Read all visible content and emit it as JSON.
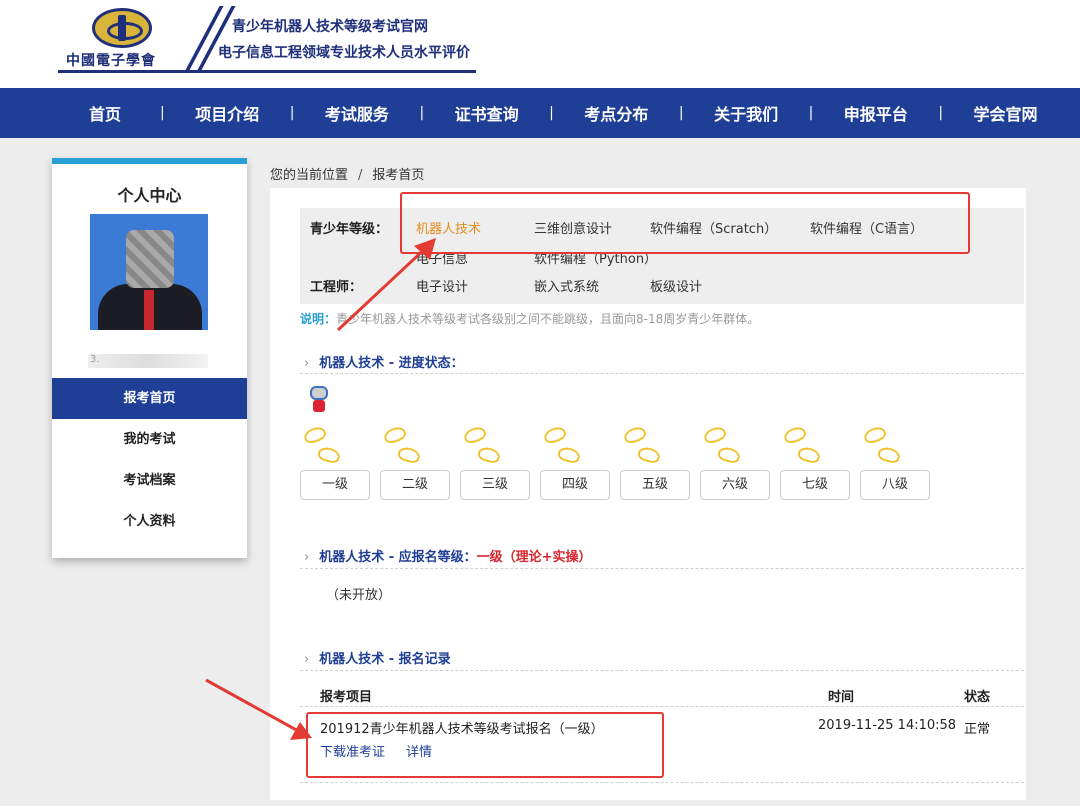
{
  "header": {
    "logo_text": "中國電子學會",
    "title_line1": "青少年机器人技术等级考试官网",
    "title_line2": "电子信息工程领域专业技术人员水平评价"
  },
  "nav": [
    "首页",
    "项目介绍",
    "考试服务",
    "证书查询",
    "考点分布",
    "关于我们",
    "申报平台",
    "学会官网"
  ],
  "sidebar": {
    "title": "个人中心",
    "id_text": "3.",
    "menu": [
      "报考首页",
      "我的考试",
      "考试档案",
      "个人资料"
    ]
  },
  "breadcrumb": {
    "prefix": "您的当前位置",
    "separator": "/",
    "current": "报考首页"
  },
  "categories": {
    "youth_label": "青少年等级：",
    "youth_items": [
      "机器人技术",
      "三维创意设计",
      "软件编程（Scratch）",
      "软件编程（C语言）",
      "电子信息",
      "软件编程（Python）"
    ],
    "engineer_label": "工程师：",
    "engineer_items": [
      "电子设计",
      "嵌入式系统",
      "板级设计"
    ],
    "note_label": "说明：",
    "note_text": "青少年机器人技术等级考试各级别之间不能跳级，且面向8-18周岁青少年群体。"
  },
  "progress": {
    "title": "机器人技术 - 进度状态：",
    "levels": [
      "一级",
      "二级",
      "三级",
      "四级",
      "五级",
      "六级",
      "七级",
      "八级"
    ]
  },
  "apply_level": {
    "title": "机器人技术 - 应报名等级：",
    "value": "一级（理论+实操）",
    "status": "（未开放）"
  },
  "records": {
    "title": "机器人技术 - 报名记录",
    "headers": {
      "project": "报考项目",
      "time": "时间",
      "status": "状态"
    },
    "row": {
      "project": "201912青少年机器人技术等级考试报名（一级）",
      "time": "2019-11-25 14:10:58",
      "status": "正常",
      "link_download": "下载准考证",
      "link_detail": "详情"
    }
  },
  "colors": {
    "nav_bg": "#1f3f96",
    "accent_blue": "#2a9fd6",
    "highlight_orange": "#e68a1c",
    "annotation_red": "#e33b34"
  }
}
